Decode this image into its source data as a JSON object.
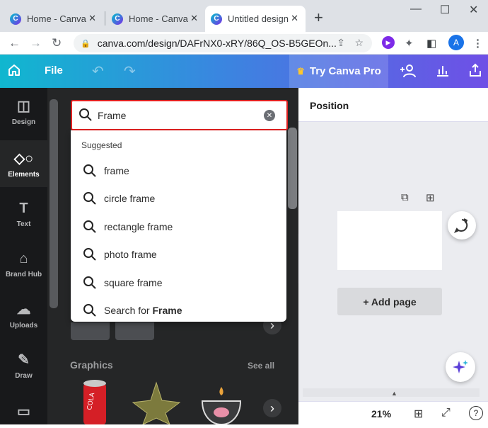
{
  "browser": {
    "tabs": [
      {
        "title": "Home - Canva",
        "active": false
      },
      {
        "title": "Home - Canva",
        "active": false
      },
      {
        "title": "Untitled design",
        "active": true
      }
    ],
    "new_tab": "+",
    "window_controls": {
      "minimize": "—",
      "maximize": "☐",
      "close": "✕"
    },
    "url": "canva.com/design/DAFrNX0-xRY/86Q_OS-B5GEOn...",
    "avatar_letter": "A"
  },
  "canva_header": {
    "file_label": "File",
    "try_pro_label": "Try Canva Pro",
    "brand_gradient": [
      "#10b7cf",
      "#6f4fe6"
    ],
    "pro_crown_color": "#ffc72c"
  },
  "left_nav": {
    "items": [
      {
        "label": "Design",
        "icon": "layout-icon",
        "active": false
      },
      {
        "label": "Elements",
        "icon": "shapes-icon",
        "active": true
      },
      {
        "label": "Text",
        "icon": "text-icon",
        "active": false
      },
      {
        "label": "Brand Hub",
        "icon": "brand-icon",
        "active": false
      },
      {
        "label": "Uploads",
        "icon": "upload-icon",
        "active": false
      },
      {
        "label": "Draw",
        "icon": "pen-icon",
        "active": false
      },
      {
        "label": "",
        "icon": "folder-icon",
        "active": false
      }
    ]
  },
  "search": {
    "value": "Frame",
    "highlight_color": "#e02020",
    "suggested_heading": "Suggested",
    "suggestions": [
      "frame",
      "circle frame",
      "rectangle frame",
      "photo frame",
      "square frame"
    ],
    "search_for_prefix": "Search for",
    "search_for_term": "Frame"
  },
  "panel": {
    "graphics_heading": "Graphics",
    "see_all_label": "See all"
  },
  "editor": {
    "position_label": "Position",
    "add_page_label": "+ Add page",
    "zoom": "21%",
    "help": "?"
  }
}
